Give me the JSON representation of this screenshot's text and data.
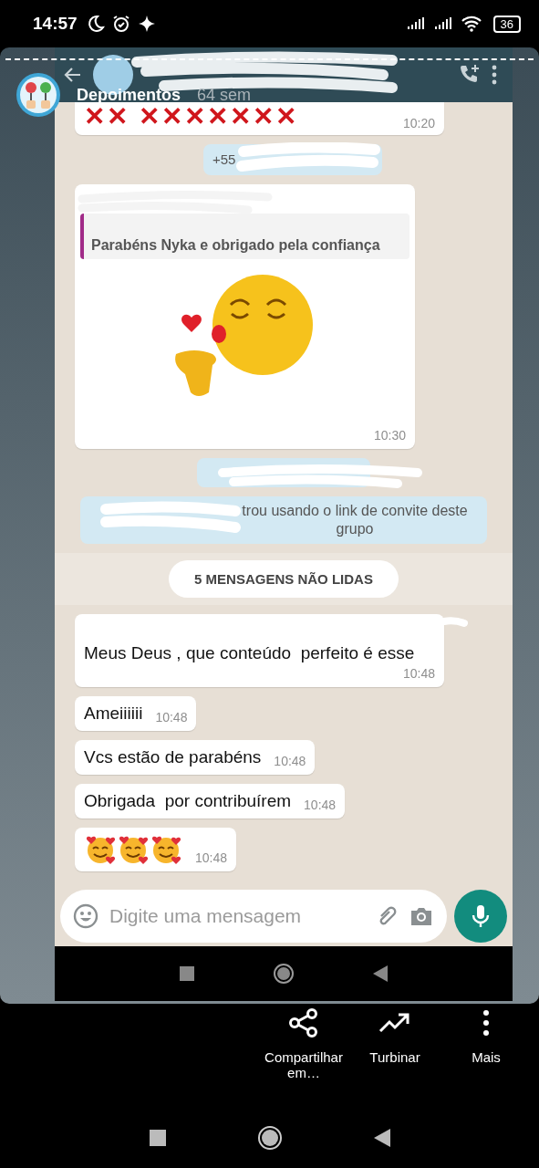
{
  "status_bar": {
    "time": "14:57",
    "battery": "36"
  },
  "story": {
    "title": "Depoimentos",
    "age": "64 sem"
  },
  "messages": [
    {
      "kind": "crosses",
      "text": "✕✕ ✕✕✕✕✕✕✕",
      "time": "10:20"
    },
    {
      "kind": "system",
      "text": "+55"
    },
    {
      "kind": "sticker",
      "quote": "Parabéns Nyka e obrigado pela confiança",
      "time": "10:30"
    },
    {
      "kind": "hidden_system"
    },
    {
      "kind": "system_long",
      "text": "trou usando o link de convite deste grupo"
    },
    {
      "kind": "unread",
      "text": "5 MENSAGENS NÃO LIDAS"
    },
    {
      "kind": "text",
      "sender_hidden": true,
      "text": "Meus Deus , que conteúdo  perfeito é esse",
      "time": "10:48"
    },
    {
      "kind": "text",
      "sender_hidden": false,
      "text": "Ameiiiiii",
      "time": "10:48"
    },
    {
      "kind": "text",
      "sender_hidden": false,
      "text": "Vcs estão de parabéns",
      "time": "10:48"
    },
    {
      "kind": "text",
      "sender_hidden": false,
      "text": "Obrigada  por contribuírem",
      "time": "10:48"
    },
    {
      "kind": "emoji",
      "emojis": [
        {
          "kind": "smiling-hearts"
        },
        {
          "kind": "smiling-hearts"
        },
        {
          "kind": "smiling-hearts"
        }
      ],
      "time": "10:48"
    }
  ],
  "composer": {
    "placeholder": "Digite uma mensagem"
  },
  "actions": [
    {
      "kind": "share",
      "label": "Compartilhar em…"
    },
    {
      "kind": "boost",
      "label": "Turbinar"
    },
    {
      "kind": "more",
      "label": "Mais"
    }
  ]
}
